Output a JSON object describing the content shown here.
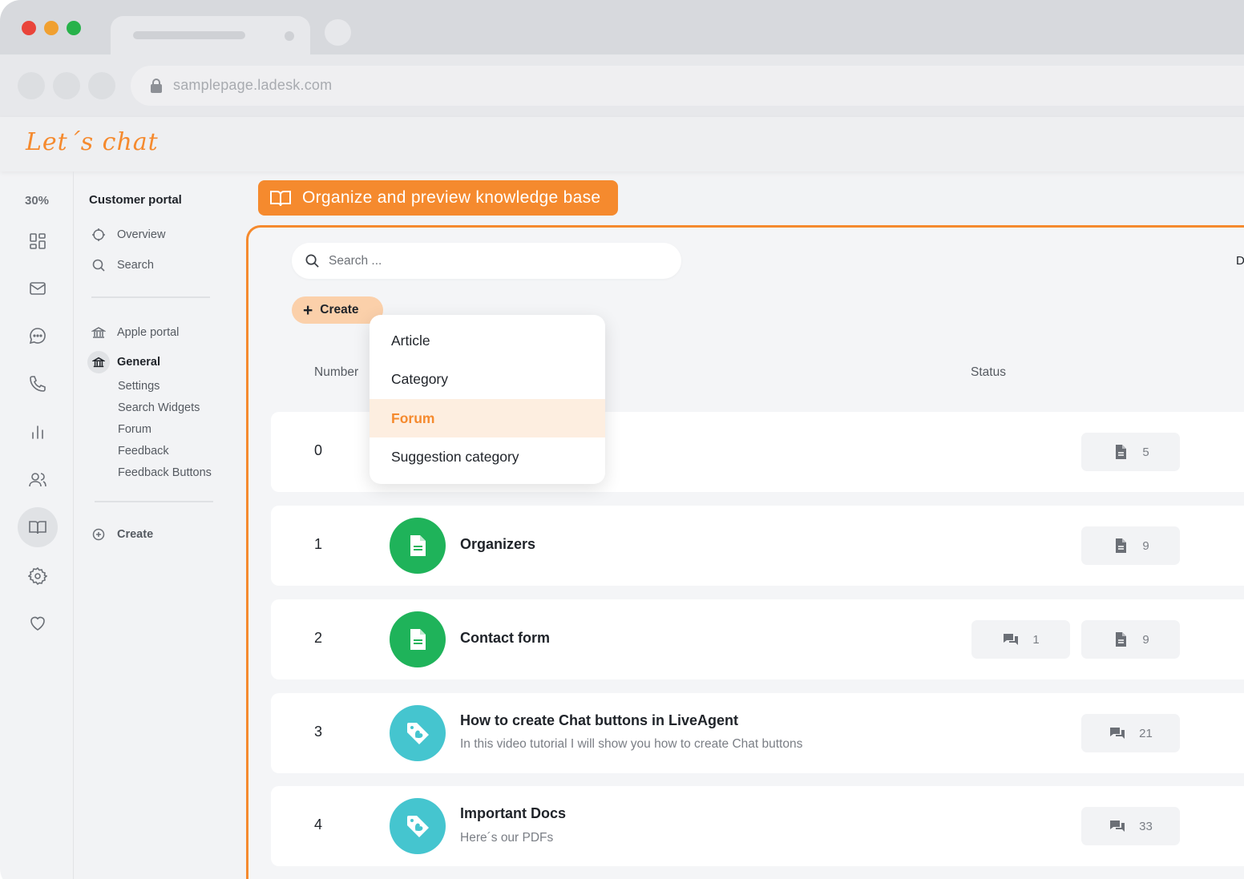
{
  "browser": {
    "url": "samplepage.ladesk.com",
    "traffic_colors": [
      "#e9443a",
      "#f0a030",
      "#27b24a"
    ]
  },
  "app": {
    "logo": "Let´s chat",
    "accent": "#f58a2e"
  },
  "rail": {
    "progress": "30%",
    "icons": [
      "dashboard-icon",
      "mail-icon",
      "chat-icon",
      "phone-icon",
      "reports-icon",
      "contacts-icon",
      "knowledge-base-icon",
      "settings-icon",
      "heart-icon"
    ]
  },
  "subnav": {
    "heading": "Customer portal",
    "overview": "Overview",
    "search": "Search",
    "apple_portal": "Apple portal",
    "general": "General",
    "children": [
      "Settings",
      "Search Widgets",
      "Forum",
      "Feedback",
      "Feedback Buttons"
    ],
    "create": "Create"
  },
  "banner": {
    "text": "Organize and preview knowledge base"
  },
  "toolbar": {
    "search_placeholder": "Search ...",
    "create_label": "Create",
    "cut_off_text": "D"
  },
  "table": {
    "col_number": "Number",
    "col_status": "Status"
  },
  "dropdown": {
    "options": [
      "Article",
      "Category",
      "Forum",
      "Suggestion category"
    ],
    "highlighted": "Forum"
  },
  "rows": [
    {
      "number": "0",
      "title": "",
      "desc": "",
      "docs": "5"
    },
    {
      "number": "1",
      "title": "Organizers",
      "desc": "",
      "docs": "9"
    },
    {
      "number": "2",
      "title": "Contact form",
      "desc": "",
      "comments": "1",
      "docs": "9"
    },
    {
      "number": "3",
      "title": "How to create Chat buttons in LiveAgent",
      "desc": "In this video tutorial I will show you how to create Chat buttons",
      "comments": "21"
    },
    {
      "number": "4",
      "title": "Important Docs",
      "desc": "Here´s our PDFs",
      "comments": "33"
    }
  ],
  "colors": {
    "green_avatar": "#1fb35a",
    "teal_avatar": "#45c5cf"
  }
}
